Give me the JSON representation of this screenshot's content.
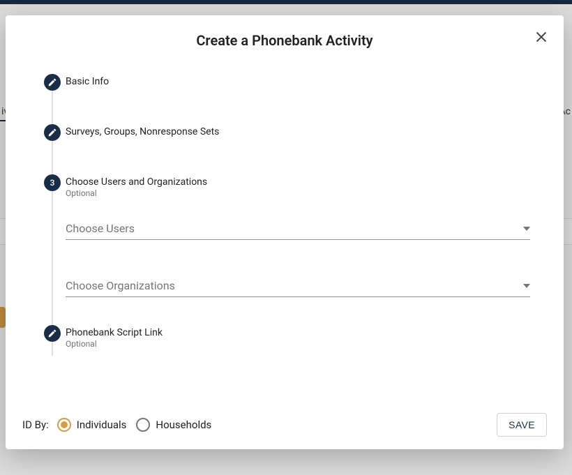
{
  "backdrop": {
    "leftText": "iv",
    "rightText": "Ac"
  },
  "modal": {
    "title": "Create a Phonebank Activity",
    "steps": {
      "basicInfo": {
        "label": "Basic Info"
      },
      "surveys": {
        "label": "Surveys, Groups, Nonresponse Sets"
      },
      "chooseUsers": {
        "number": "3",
        "label": "Choose Users and Organizations",
        "sublabel": "Optional",
        "fields": {
          "users": {
            "placeholder": "Choose Users"
          },
          "orgs": {
            "placeholder": "Choose Organizations"
          }
        }
      },
      "script": {
        "label": "Phonebank Script Link",
        "sublabel": "Optional"
      }
    },
    "footer": {
      "idByLabel": "ID By:",
      "individuals": "Individuals",
      "households": "Households",
      "selected": "individuals",
      "saveLabel": "SAVE"
    }
  }
}
